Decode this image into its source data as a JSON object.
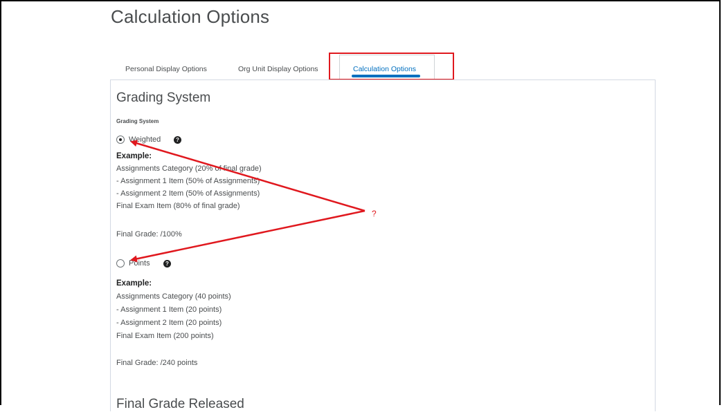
{
  "page_title": "Calculation Options",
  "tabs": [
    {
      "label": "Personal Display Options",
      "active": false
    },
    {
      "label": "Org Unit Display Options",
      "active": false
    },
    {
      "label": "Calculation Options",
      "active": true
    }
  ],
  "grading_section": {
    "title": "Grading System",
    "field_label": "Grading System",
    "options": [
      {
        "label": "Weighted",
        "checked": true,
        "help_icon": "question-circle-icon",
        "example_heading": "Example:",
        "example_lines": [
          "Assignments Category (20% of final grade)",
          "- Assignment 1 Item (50% of Assignments)",
          "- Assignment 2 Item (50% of Assignments)",
          "Final Exam Item (80% of final grade)"
        ],
        "final_grade": "Final Grade: /100%"
      },
      {
        "label": "Points",
        "checked": false,
        "help_icon": "question-circle-icon",
        "example_heading": "Example:",
        "example_lines": [
          "Assignments Category (40 points)",
          "- Assignment 1 Item (20 points)",
          "- Assignment 2 Item (20 points)",
          "Final Exam Item (200 points)"
        ],
        "final_grade": "Final Grade: /240 points"
      }
    ]
  },
  "next_section_title": "Final Grade Released",
  "annotation": {
    "text": "?",
    "color": "#e0181e"
  },
  "colors": {
    "accent": "#006fbf",
    "highlight": "#e0181e",
    "text": "#494c4e"
  }
}
